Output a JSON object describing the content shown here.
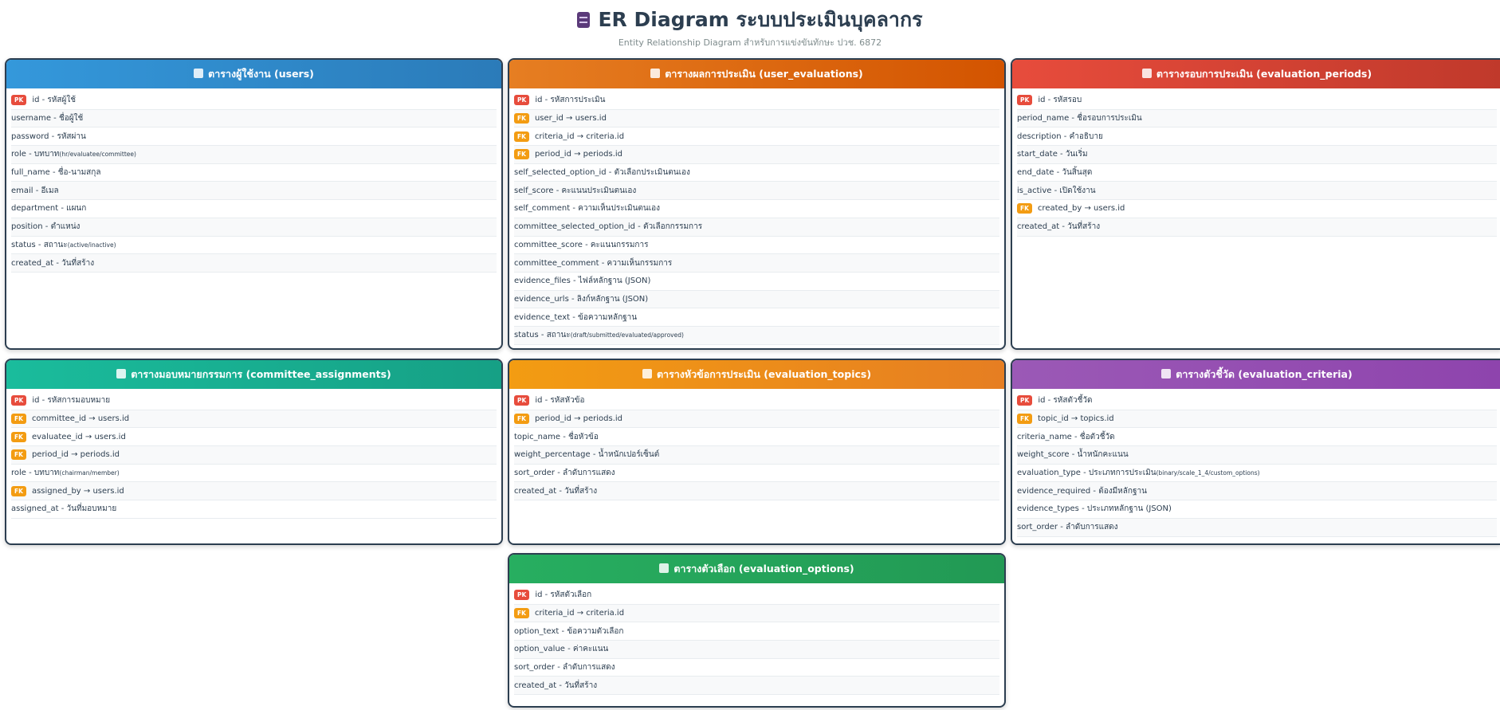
{
  "header": {
    "title": "ER Diagram ระบบประเมินบุคลากร",
    "subtitle": "Entity Relationship Diagram สำหรับการแข่งขันทักษะ ปวช. 6872"
  },
  "colors": {
    "pk": "#e74c3c",
    "fk": "#f39c12",
    "border": "#2c3e50"
  },
  "tables": [
    {
      "key": "users",
      "icon": "users-icon",
      "color": "#3498db",
      "title": "ตารางผู้ใช้งาน (users)",
      "fields": [
        {
          "badge": "PK",
          "text": "id - รหัสผู้ใช้",
          "note": ""
        },
        {
          "badge": "",
          "text": "username - ชื่อผู้ใช้",
          "note": ""
        },
        {
          "badge": "",
          "text": "password - รหัสผ่าน",
          "note": ""
        },
        {
          "badge": "",
          "text": "role - บทบาท",
          "note": "(hr/evaluatee/committee)"
        },
        {
          "badge": "",
          "text": "full_name - ชื่อ-นามสกุล",
          "note": ""
        },
        {
          "badge": "",
          "text": "email - อีเมล",
          "note": ""
        },
        {
          "badge": "",
          "text": "department - แผนก",
          "note": ""
        },
        {
          "badge": "",
          "text": "position - ตำแหน่ง",
          "note": ""
        },
        {
          "badge": "",
          "text": "status - สถานะ",
          "note": "(active/inactive)"
        },
        {
          "badge": "",
          "text": "created_at - วันที่สร้าง",
          "note": ""
        }
      ]
    },
    {
      "key": "user_evaluations",
      "icon": "chart-icon",
      "color": "#e67e22",
      "title": "ตารางผลการประเมิน (user_evaluations)",
      "fields": [
        {
          "badge": "PK",
          "text": "id - รหัสการประเมิน",
          "note": ""
        },
        {
          "badge": "FK",
          "text": "user_id → users.id",
          "note": ""
        },
        {
          "badge": "FK",
          "text": "criteria_id → criteria.id",
          "note": ""
        },
        {
          "badge": "FK",
          "text": "period_id → periods.id",
          "note": ""
        },
        {
          "badge": "",
          "text": "self_selected_option_id - ตัวเลือกประเมินตนเอง",
          "note": ""
        },
        {
          "badge": "",
          "text": "self_score - คะแนนประเมินตนเอง",
          "note": ""
        },
        {
          "badge": "",
          "text": "self_comment - ความเห็นประเมินตนเอง",
          "note": ""
        },
        {
          "badge": "",
          "text": "committee_selected_option_id - ตัวเลือกกรรมการ",
          "note": ""
        },
        {
          "badge": "",
          "text": "committee_score - คะแนนกรรมการ",
          "note": ""
        },
        {
          "badge": "",
          "text": "committee_comment - ความเห็นกรรมการ",
          "note": ""
        },
        {
          "badge": "",
          "text": "evidence_files - ไฟล์หลักฐาน (JSON)",
          "note": ""
        },
        {
          "badge": "",
          "text": "evidence_urls - ลิงก์หลักฐาน (JSON)",
          "note": ""
        },
        {
          "badge": "",
          "text": "evidence_text - ข้อความหลักฐาน",
          "note": ""
        },
        {
          "badge": "",
          "text": "status - สถานะ",
          "note": "(draft/submitted/evaluated/approved)"
        }
      ]
    },
    {
      "key": "evaluation_periods",
      "icon": "calendar-icon",
      "color": "#e74c3c",
      "title": "ตารางรอบการประเมิน (evaluation_periods)",
      "fields": [
        {
          "badge": "PK",
          "text": "id - รหัสรอบ",
          "note": ""
        },
        {
          "badge": "",
          "text": "period_name - ชื่อรอบการประเมิน",
          "note": ""
        },
        {
          "badge": "",
          "text": "description - คำอธิบาย",
          "note": ""
        },
        {
          "badge": "",
          "text": "start_date - วันเริ่ม",
          "note": ""
        },
        {
          "badge": "",
          "text": "end_date - วันสิ้นสุด",
          "note": ""
        },
        {
          "badge": "",
          "text": "is_active - เปิดใช้งาน",
          "note": ""
        },
        {
          "badge": "FK",
          "text": "created_by → users.id",
          "note": ""
        },
        {
          "badge": "",
          "text": "created_at - วันที่สร้าง",
          "note": ""
        }
      ]
    },
    {
      "key": "committee_assignments",
      "icon": "person-icon",
      "color": "#1abc9c",
      "title": "ตารางมอบหมายกรรมการ (committee_assignments)",
      "fields": [
        {
          "badge": "PK",
          "text": "id - รหัสการมอบหมาย",
          "note": ""
        },
        {
          "badge": "FK",
          "text": "committee_id → users.id",
          "note": ""
        },
        {
          "badge": "FK",
          "text": "evaluatee_id → users.id",
          "note": ""
        },
        {
          "badge": "FK",
          "text": "period_id → periods.id",
          "note": ""
        },
        {
          "badge": "",
          "text": "role - บทบาท",
          "note": "(chairman/member)"
        },
        {
          "badge": "FK",
          "text": "assigned_by → users.id",
          "note": ""
        },
        {
          "badge": "",
          "text": "assigned_at - วันที่มอบหมาย",
          "note": ""
        }
      ]
    },
    {
      "key": "evaluation_topics",
      "icon": "clipboard-icon",
      "color": "#f39c12",
      "title": "ตารางหัวข้อการประเมิน (evaluation_topics)",
      "fields": [
        {
          "badge": "PK",
          "text": "id - รหัสหัวข้อ",
          "note": ""
        },
        {
          "badge": "FK",
          "text": "period_id → periods.id",
          "note": ""
        },
        {
          "badge": "",
          "text": "topic_name - ชื่อหัวข้อ",
          "note": ""
        },
        {
          "badge": "",
          "text": "weight_percentage - น้ำหนักเปอร์เซ็นต์",
          "note": ""
        },
        {
          "badge": "",
          "text": "sort_order - ลำดับการแสดง",
          "note": ""
        },
        {
          "badge": "",
          "text": "created_at - วันที่สร้าง",
          "note": ""
        }
      ]
    },
    {
      "key": "evaluation_criteria",
      "icon": "target-icon",
      "color": "#9b59b6",
      "title": "ตารางตัวชี้วัด (evaluation_criteria)",
      "fields": [
        {
          "badge": "PK",
          "text": "id - รหัสตัวชี้วัด",
          "note": ""
        },
        {
          "badge": "FK",
          "text": "topic_id → topics.id",
          "note": ""
        },
        {
          "badge": "",
          "text": "criteria_name - ชื่อตัวชี้วัด",
          "note": ""
        },
        {
          "badge": "",
          "text": "weight_score - น้ำหนักคะแนน",
          "note": ""
        },
        {
          "badge": "",
          "text": "evaluation_type - ประเภทการประเมิน",
          "note": "(binary/scale_1_4/custom_options)"
        },
        {
          "badge": "",
          "text": "evidence_required - ต้องมีหลักฐาน",
          "note": ""
        },
        {
          "badge": "",
          "text": "evidence_types - ประเภทหลักฐาน (JSON)",
          "note": ""
        },
        {
          "badge": "",
          "text": "sort_order - ลำดับการแสดง",
          "note": ""
        }
      ]
    },
    {
      "key": "evaluation_options",
      "icon": "lightning-icon",
      "color": "#27ae60",
      "title": "ตารางตัวเลือก (evaluation_options)",
      "fields": [
        {
          "badge": "PK",
          "text": "id - รหัสตัวเลือก",
          "note": ""
        },
        {
          "badge": "FK",
          "text": "criteria_id → criteria.id",
          "note": ""
        },
        {
          "badge": "",
          "text": "option_text - ข้อความตัวเลือก",
          "note": ""
        },
        {
          "badge": "",
          "text": "option_value - ค่าคะแนน",
          "note": ""
        },
        {
          "badge": "",
          "text": "sort_order - ลำดับการแสดง",
          "note": ""
        },
        {
          "badge": "",
          "text": "created_at - วันที่สร้าง",
          "note": ""
        }
      ]
    }
  ]
}
